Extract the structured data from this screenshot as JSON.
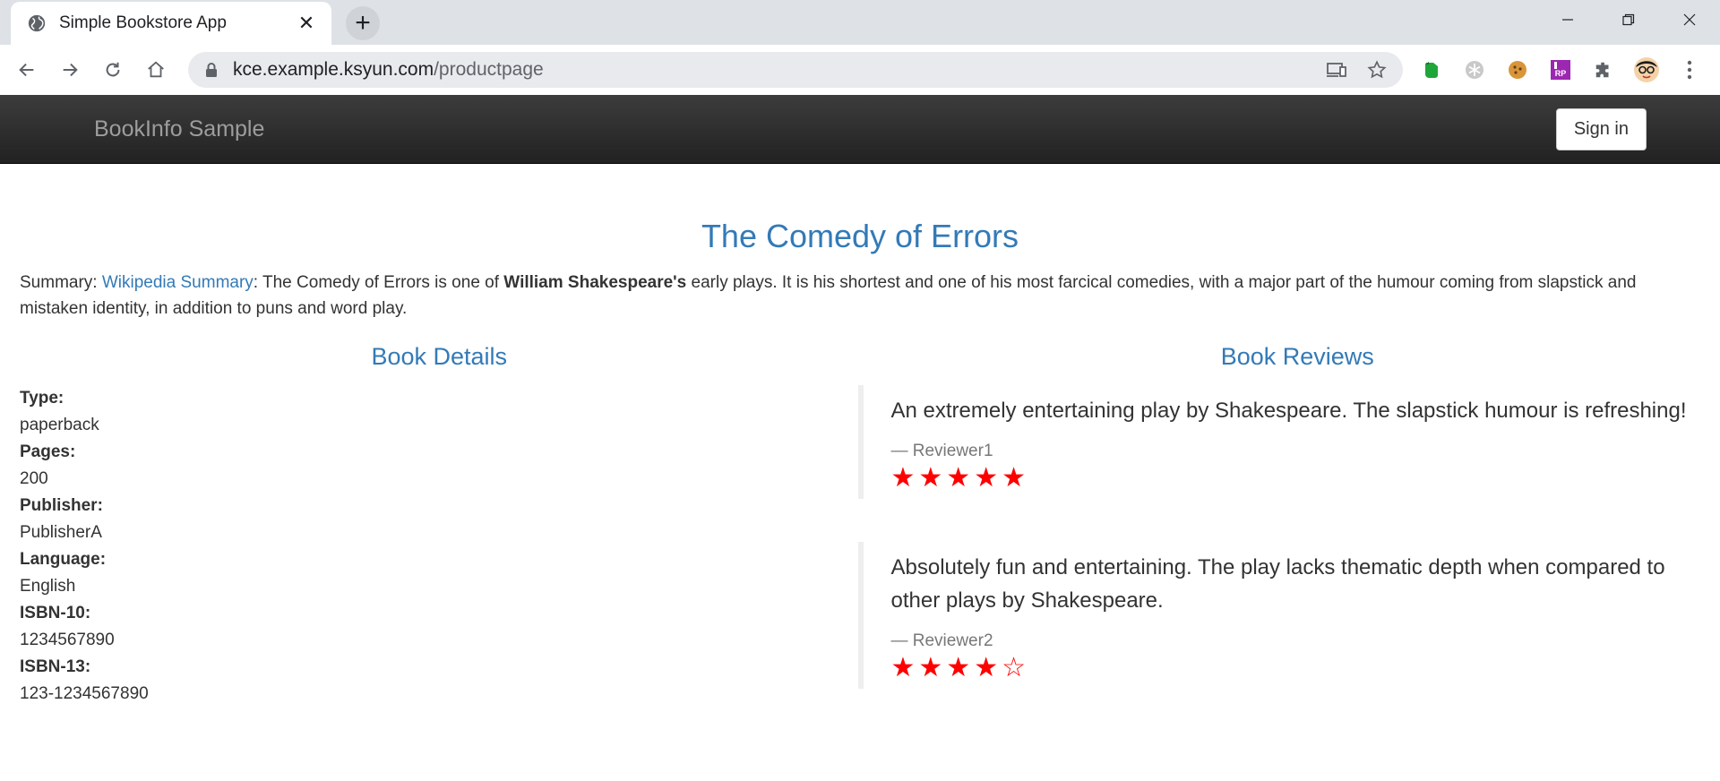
{
  "browser": {
    "tab_title": "Simple Bookstore App",
    "tab_close": "✕",
    "new_tab": "+",
    "url_host": "kce.example.ksyun.com",
    "url_path": "/productpage"
  },
  "navbar": {
    "brand": "BookInfo Sample",
    "signin_label": "Sign in"
  },
  "book": {
    "title": "The Comedy of Errors",
    "summary_prefix": "Summary: ",
    "summary_link": "Wikipedia Summary",
    "summary_part1": ": The Comedy of Errors is one of ",
    "summary_bold": "William Shakespeare's",
    "summary_part2": " early plays. It is his shortest and one of his most farcical comedies, with a major part of the humour coming from slapstick and mistaken identity, in addition to puns and word play."
  },
  "details": {
    "heading": "Book Details",
    "fields": [
      {
        "label": "Type:",
        "value": "paperback"
      },
      {
        "label": "Pages:",
        "value": "200"
      },
      {
        "label": "Publisher:",
        "value": "PublisherA"
      },
      {
        "label": "Language:",
        "value": "English"
      },
      {
        "label": "ISBN-10:",
        "value": "1234567890"
      },
      {
        "label": "ISBN-13:",
        "value": "123-1234567890"
      }
    ]
  },
  "reviews": {
    "heading": "Book Reviews",
    "star_color": "#ff0000",
    "items": [
      {
        "text": "An extremely entertaining play by Shakespeare. The slapstick humour is refreshing!",
        "reviewer": "— Reviewer1",
        "rating": 5,
        "max_rating": 5
      },
      {
        "text": "Absolutely fun and entertaining. The play lacks thematic depth when compared to other plays by Shakespeare.",
        "reviewer": "— Reviewer2",
        "rating": 4,
        "max_rating": 5
      }
    ]
  }
}
